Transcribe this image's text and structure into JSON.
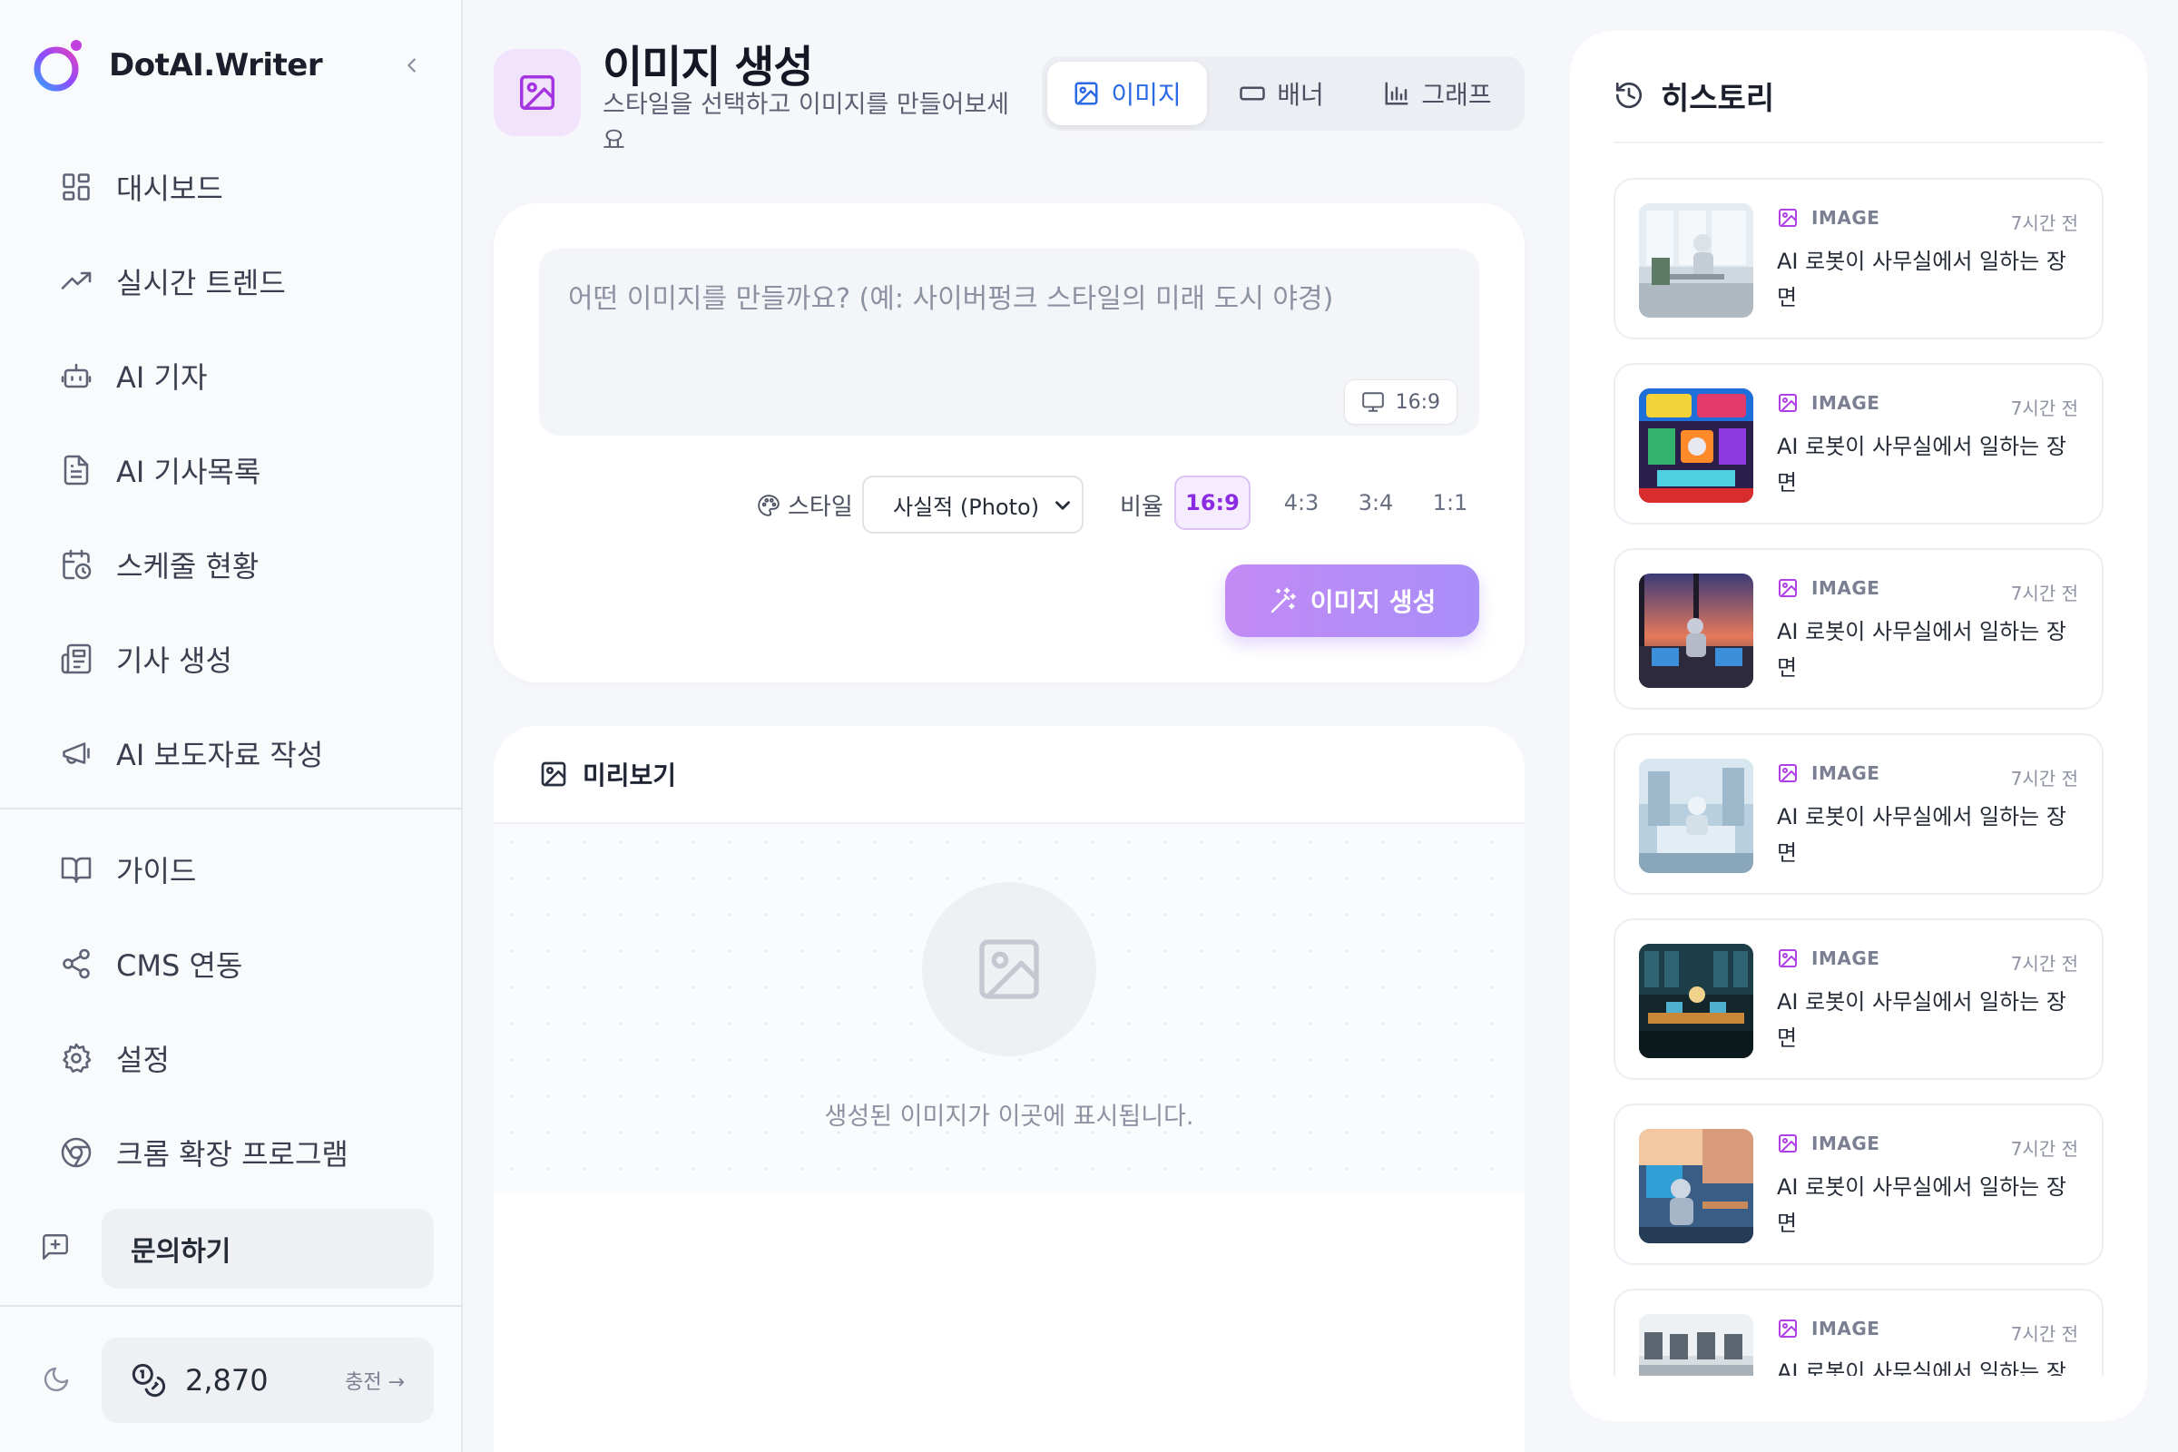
{
  "brand": {
    "name": "DotAI.Writer"
  },
  "sidebar": {
    "items": [
      {
        "label": "대시보드",
        "icon": "dashboard-icon"
      },
      {
        "label": "실시간 트렌드",
        "icon": "trend-icon"
      },
      {
        "label": "AI 기자",
        "icon": "bot-icon"
      },
      {
        "label": "AI 기사목록",
        "icon": "document-icon"
      },
      {
        "label": "스케줄 현황",
        "icon": "calendar-clock-icon"
      },
      {
        "label": "기사 생성",
        "icon": "newspaper-icon"
      },
      {
        "label": "AI 보도자료 작성",
        "icon": "megaphone-icon"
      }
    ],
    "items2": [
      {
        "label": "가이드",
        "icon": "book-icon"
      },
      {
        "label": "CMS 연동",
        "icon": "share-icon"
      },
      {
        "label": "설정",
        "icon": "gear-icon"
      },
      {
        "label": "크롬 확장 프로그램",
        "icon": "chrome-icon"
      }
    ],
    "inquiry": "문의하기",
    "credits": "2,870",
    "charge": "충전 →"
  },
  "header": {
    "title": "이미지 생성",
    "subtitle": "스타일을 선택하고 이미지를 만들어보세요"
  },
  "tabs": [
    {
      "label": "이미지",
      "active": true
    },
    {
      "label": "배너",
      "active": false
    },
    {
      "label": "그래프",
      "active": false
    }
  ],
  "prompt": {
    "placeholder": "어떤 이미지를 만들까요? (예: 사이버펑크 스타일의 미래 도시 야경)",
    "ratio_chip": "16:9"
  },
  "controls": {
    "style_label": "스타일",
    "style_value": "사실적 (Photo)",
    "ratio_label": "비율",
    "ratios": [
      "16:9",
      "4:3",
      "3:4",
      "1:1"
    ],
    "selected_ratio": "16:9"
  },
  "generate_button": "이미지 생성",
  "preview": {
    "title": "미리보기",
    "placeholder": "생성된 이미지가 이곳에 표시됩니다."
  },
  "history": {
    "title": "히스토리",
    "items": [
      {
        "type": "IMAGE",
        "time": "7시간 전",
        "title": "AI 로봇이 사무실에서 일하는 장면"
      },
      {
        "type": "IMAGE",
        "time": "7시간 전",
        "title": "AI 로봇이 사무실에서 일하는 장면"
      },
      {
        "type": "IMAGE",
        "time": "7시간 전",
        "title": "AI 로봇이 사무실에서 일하는 장면"
      },
      {
        "type": "IMAGE",
        "time": "7시간 전",
        "title": "AI 로봇이 사무실에서 일하는 장면"
      },
      {
        "type": "IMAGE",
        "time": "7시간 전",
        "title": "AI 로봇이 사무실에서 일하는 장면"
      },
      {
        "type": "IMAGE",
        "time": "7시간 전",
        "title": "AI 로봇이 사무실에서 일하는 장면"
      },
      {
        "type": "IMAGE",
        "time": "7시간 전",
        "title": "AI 로봇이 사무실에서 일하는 장면"
      }
    ]
  },
  "colors": {
    "accent": "#8a2be2",
    "tab_active": "#2b6ae6",
    "button_gradient_start": "#c28af5",
    "button_gradient_end": "#a98ef8"
  }
}
